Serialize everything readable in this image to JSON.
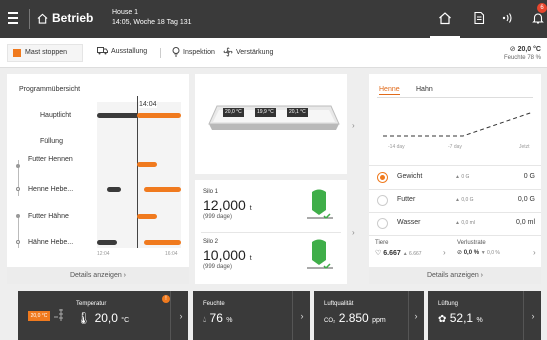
{
  "header": {
    "title": "Betrieb",
    "house": "House 1",
    "datetime": "14:05, Woche 18 Tag 131",
    "notification_count": "6"
  },
  "actions": {
    "stop": "Mast stoppen",
    "stable": "Ausstallung",
    "inspection": "Inspektion",
    "boost": "Verstärkung",
    "temp": "20,0 °C",
    "humidity": "Feuchte 78 %"
  },
  "program": {
    "title": "Programmübersicht",
    "now": "14:04",
    "rows": [
      "Hauptlicht",
      "Füllung",
      "Futter Hennen",
      "Henne Hebe...",
      "Futter Hähne",
      "Hähne Hebe..."
    ],
    "axis_start": "12:04",
    "axis_end": "16:04",
    "details": "Details anzeigen"
  },
  "tray": {
    "tags": [
      "20,0 °C",
      "19,9 °C",
      "20,1 °C"
    ]
  },
  "silos": [
    {
      "label": "Silo 1",
      "value": "12,000",
      "unit": "t",
      "sub": "(999 dage)"
    },
    {
      "label": "Silo 2",
      "value": "10,000",
      "unit": "t",
      "sub": "(999 dage)"
    }
  ],
  "weights": {
    "tabs": [
      "Henne",
      "Hahn"
    ],
    "x_labels": [
      "-14 day",
      "-7 day",
      "Jetzt"
    ],
    "rows": [
      {
        "name": "Gewicht",
        "delta": "▲ 0 G",
        "value": "0 G"
      },
      {
        "name": "Futter",
        "delta": "▲ 0,0 G",
        "value": "0,0 G"
      },
      {
        "name": "Wasser",
        "delta": "▲ 0,0 ml",
        "value": "0,0 ml"
      }
    ],
    "animals_label": "Tiere",
    "animals_value": "6.667",
    "animals_delta": "▲ 6.667",
    "loss_label": "Verlustrate",
    "loss_value": "0,0 %",
    "loss_delta": "▼ 0,0 %",
    "details": "Details anzeigen"
  },
  "tiles": [
    {
      "title": "Temperatur",
      "value": "20,0",
      "unit": "°C",
      "badge": "20,0 °C"
    },
    {
      "title": "Feuchte",
      "value": "76",
      "unit": "%"
    },
    {
      "title": "Luftqualität",
      "prefix": "CO₂",
      "value": "2.850",
      "unit": "ppm"
    },
    {
      "title": "Lüftung",
      "value": "52,1",
      "unit": "%"
    }
  ],
  "colors": {
    "accent": "#f07a1e",
    "dark": "#3a3a3a",
    "green": "#3fae49"
  }
}
